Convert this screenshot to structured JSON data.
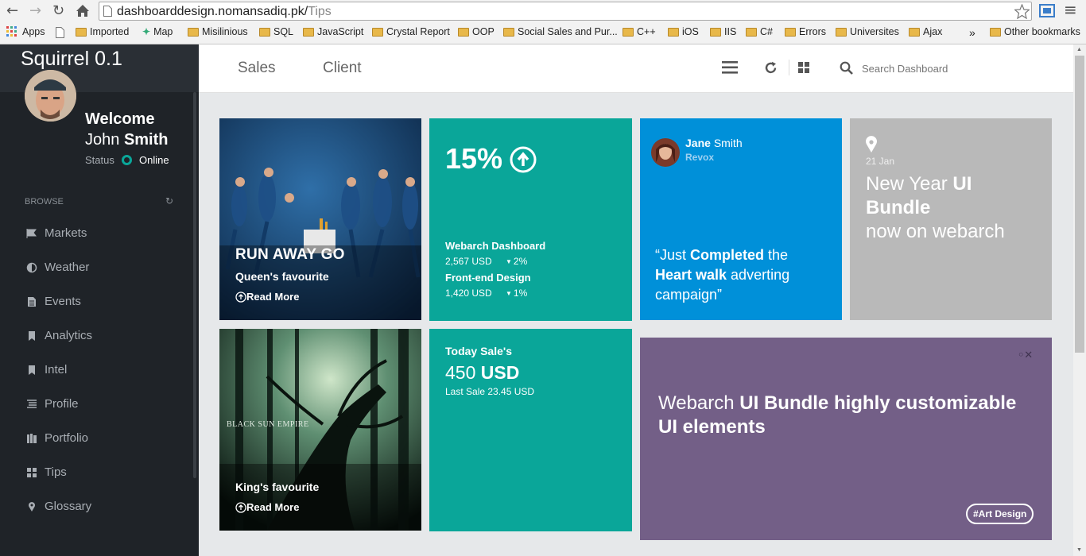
{
  "browser": {
    "url_host": "dashboarddesign.nomansadiq.pk/",
    "url_path": "Tips",
    "bookmarks": [
      "Apps",
      "Imported",
      "Map",
      "Misilinious",
      "SQL",
      "JavaScript",
      "Crystal Report",
      "OOP",
      "Social Sales and Pur...",
      "C++",
      "iOS",
      "IIS",
      "C#",
      "Errors",
      "Universites",
      "Ajax"
    ],
    "bookmarks_overflow": "»",
    "other_bookmarks": "Other bookmarks"
  },
  "sidebar": {
    "brand": "Squirrel 0.1",
    "welcome": "Welcome",
    "first_name": "John",
    "last_name": "Smith",
    "status_label": "Status",
    "status_value": "Online",
    "browse_label": "BROWSE",
    "items": [
      {
        "label": "Markets",
        "icon": "flag-icon"
      },
      {
        "label": "Weather",
        "icon": "half-circle-icon"
      },
      {
        "label": "Events",
        "icon": "document-icon"
      },
      {
        "label": "Analytics",
        "icon": "bookmark-icon"
      },
      {
        "label": "Intel",
        "icon": "bookmark-icon"
      },
      {
        "label": "Profile",
        "icon": "list-icon"
      },
      {
        "label": "Portfolio",
        "icon": "books-icon"
      },
      {
        "label": "Tips",
        "icon": "grid-icon"
      },
      {
        "label": "Glossary",
        "icon": "map-pin-icon"
      }
    ]
  },
  "header": {
    "tabs": [
      "Sales",
      "Client"
    ],
    "search_placeholder": "Search Dashboard"
  },
  "tiles": {
    "runaway": {
      "title": "RUN AWAY GO",
      "subtitle": "Queen's favourite",
      "link": "Read More"
    },
    "stats": {
      "percent": "15%",
      "item1_name": "Webarch Dashboard",
      "item1_value": "2,567 USD",
      "item1_change": "2%",
      "item2_name": "Front-end Design",
      "item2_value": "1,420 USD",
      "item2_change": "1%"
    },
    "quote": {
      "first": "Jane",
      "last": "Smith",
      "company": "Revox",
      "q1": "“Just ",
      "q2": "Completed",
      "q3": " the",
      "q4": "Heart walk",
      "q5": " adverting",
      "q6": "campaign”"
    },
    "news": {
      "date": "21 Jan",
      "t1": "New Year ",
      "t2": "UI",
      "t3": "Bundle",
      "t4": "now on webarch"
    },
    "forest": {
      "subtitle": "King's favourite",
      "link": "Read More",
      "album_text": "BLACK SUN EMPIRE"
    },
    "sales": {
      "label": "Today Sale's",
      "amount": "450",
      "currency": "USD",
      "last": "Last Sale 23.45 USD"
    },
    "promo": {
      "t1": "Webarch ",
      "t2": "UI Bundle highly customizable",
      "t3": "UI elements",
      "tag": "#Art Design"
    }
  },
  "colors": {
    "teal": "#0aa699",
    "blue": "#0090d9",
    "grey": "#b9b9b9",
    "purple": "#735f87",
    "sidebar": "#1f2328"
  }
}
